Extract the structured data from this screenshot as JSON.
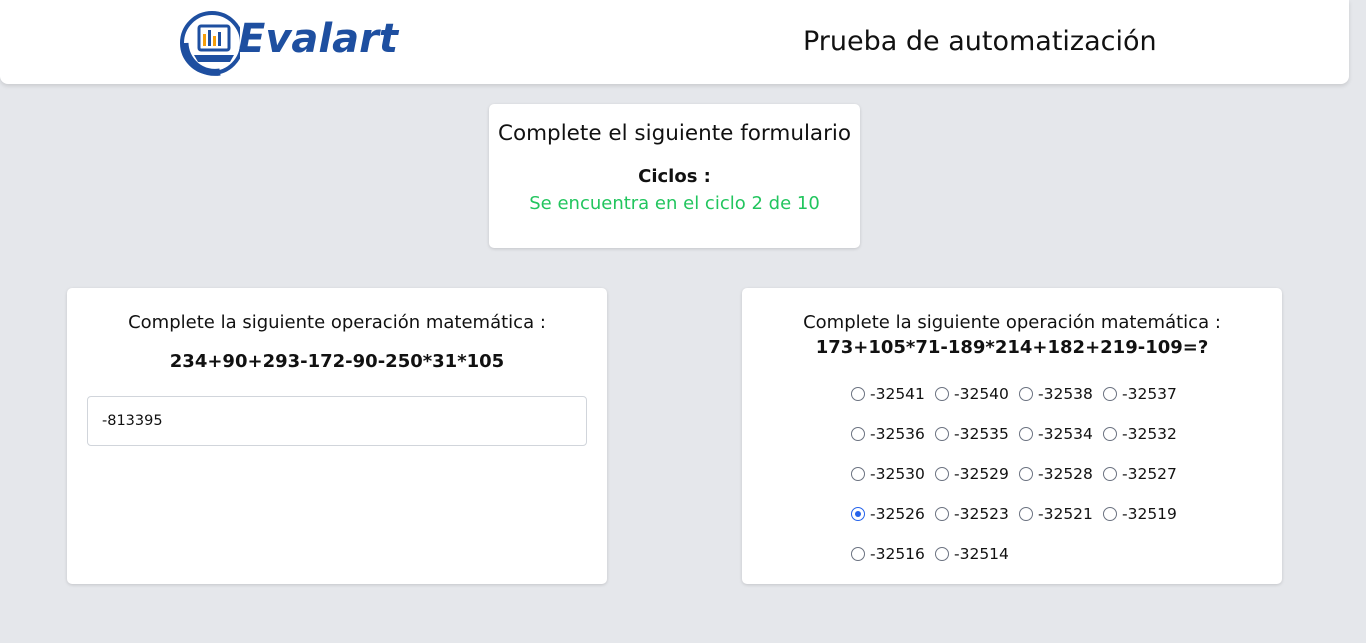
{
  "header": {
    "logo_text": "Evalart",
    "title": "Prueba de automatización"
  },
  "cycle": {
    "heading": "Complete el siguiente formulario",
    "label": "Ciclos :",
    "status": "Se encuentra en el ciclo 2 de 10",
    "status_color": "#22c55e"
  },
  "left_question": {
    "prompt": "Complete la siguiente operación matemática :",
    "expression": "234+90+293-172-90-250*31*105",
    "answer_value": "-813395"
  },
  "right_question": {
    "prompt": "Complete la siguiente operación matemática :",
    "expression": "173+105*71-189*214+182+219-109=?",
    "selected": "-32526",
    "options": [
      "-32541",
      "-32540",
      "-32538",
      "-32537",
      "-32536",
      "-32535",
      "-32534",
      "-32532",
      "-32530",
      "-32529",
      "-32528",
      "-32527",
      "-32526",
      "-32523",
      "-32521",
      "-32519",
      "-32516",
      "-32514"
    ]
  },
  "colors": {
    "background": "#e5e7eb",
    "brand": "#1e4fa0",
    "radio_selected": "#2563eb"
  }
}
